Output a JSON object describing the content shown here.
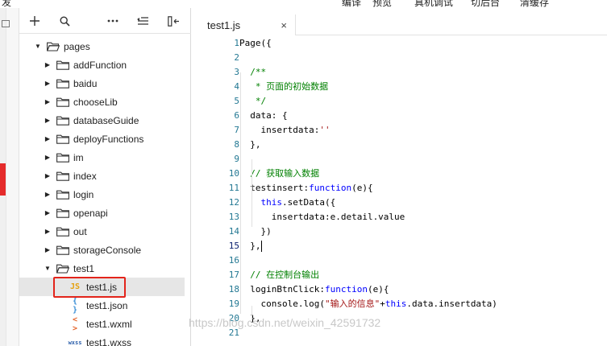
{
  "top_toolbar": {
    "left_label": "发",
    "items": [
      "编译",
      "预览",
      "真机调试",
      "切后台",
      "清缓存"
    ]
  },
  "explorer": {
    "toolbar_icons": [
      "add-icon",
      "search-icon",
      "more-icon",
      "collapse-icon",
      "split-icon"
    ],
    "tree": [
      {
        "label": "pages",
        "type": "folder",
        "expanded": true,
        "depth": 0
      },
      {
        "label": "addFunction",
        "type": "folder",
        "expanded": false,
        "depth": 1
      },
      {
        "label": "baidu",
        "type": "folder",
        "expanded": false,
        "depth": 1
      },
      {
        "label": "chooseLib",
        "type": "folder",
        "expanded": false,
        "depth": 1
      },
      {
        "label": "databaseGuide",
        "type": "folder",
        "expanded": false,
        "depth": 1
      },
      {
        "label": "deployFunctions",
        "type": "folder",
        "expanded": false,
        "depth": 1
      },
      {
        "label": "im",
        "type": "folder",
        "expanded": false,
        "depth": 1
      },
      {
        "label": "index",
        "type": "folder",
        "expanded": false,
        "depth": 1
      },
      {
        "label": "login",
        "type": "folder",
        "expanded": false,
        "depth": 1
      },
      {
        "label": "openapi",
        "type": "folder",
        "expanded": false,
        "depth": 1
      },
      {
        "label": "out",
        "type": "folder",
        "expanded": false,
        "depth": 1
      },
      {
        "label": "storageConsole",
        "type": "folder",
        "expanded": false,
        "depth": 1
      },
      {
        "label": "test1",
        "type": "folder",
        "expanded": true,
        "depth": 1
      },
      {
        "label": "test1.js",
        "type": "file",
        "badge": "JS",
        "badge_color": "#e5a00d",
        "selected": true,
        "depth": 2
      },
      {
        "label": "test1.json",
        "type": "file",
        "badge": "{ }",
        "badge_color": "#3a8fd6",
        "depth": 2
      },
      {
        "label": "test1.wxml",
        "type": "file",
        "badge": "< >",
        "badge_color": "#e5662d",
        "depth": 2
      },
      {
        "label": "test1.wxss",
        "type": "file",
        "badge": "wxss",
        "badge_color": "#2b5fab",
        "depth": 2
      }
    ]
  },
  "editor": {
    "tab_label": "test1.js",
    "tab_close": "×",
    "current_line": 15,
    "lines": [
      [
        [
          "Page({",
          ""
        ]
      ],
      [],
      [
        [
          "  /**",
          "cm"
        ]
      ],
      [
        [
          "   * 页面的初始数据",
          "cm"
        ]
      ],
      [
        [
          "   */",
          "cm"
        ]
      ],
      [
        [
          "  data: {",
          ""
        ]
      ],
      [
        [
          "    insertdata:",
          ""
        ],
        [
          "''",
          "str"
        ]
      ],
      [
        [
          "  },",
          ""
        ]
      ],
      [],
      [
        [
          "  // 获取输入数据",
          "cm"
        ]
      ],
      [
        [
          "  testinsert:",
          ""
        ],
        [
          "function",
          "kw"
        ],
        [
          "(e){",
          ""
        ]
      ],
      [
        [
          "    ",
          ""
        ],
        [
          "this",
          "kw"
        ],
        [
          ".setData({",
          ""
        ]
      ],
      [
        [
          "      insertdata:e.detail.value",
          ""
        ]
      ],
      [
        [
          "    })",
          ""
        ]
      ],
      [
        [
          "  },",
          ""
        ]
      ],
      [],
      [
        [
          "  // 在控制台输出",
          "cm"
        ]
      ],
      [
        [
          "  loginBtnClick:",
          ""
        ],
        [
          "function",
          "kw"
        ],
        [
          "(e){",
          ""
        ]
      ],
      [
        [
          "    console.log(",
          ""
        ],
        [
          "\"输入的信息\"",
          "str"
        ],
        [
          "+",
          ""
        ],
        [
          "this",
          "kw"
        ],
        [
          ".data.insertdata)",
          ""
        ]
      ],
      [
        [
          "  },",
          ""
        ]
      ],
      []
    ]
  },
  "watermark": "https://blog.csdn.net/weixin_42591732",
  "colors": {
    "highlight_box": "#e3241b",
    "keyword": "#0000ff",
    "comment": "#008000",
    "string": "#a31515",
    "line_number": "#237893"
  }
}
